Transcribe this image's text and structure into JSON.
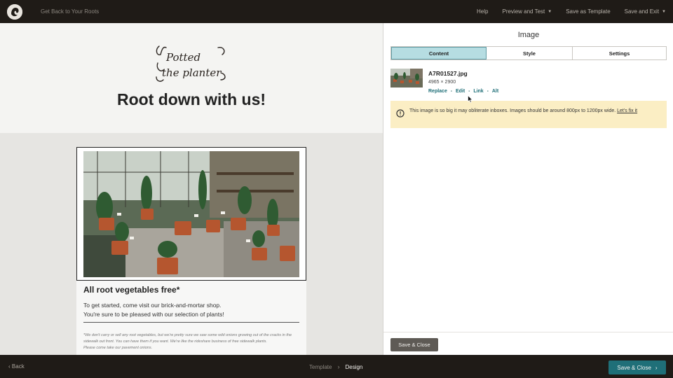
{
  "topbar": {
    "campaign_name": "Get Back to Your Roots",
    "help": "Help",
    "preview_and_test": "Preview and Test",
    "save_as_template": "Save as Template",
    "save_and_exit": "Save and Exit"
  },
  "preview": {
    "headline": "Root down with us!",
    "copy_heading": "All root vegetables free*",
    "copy_line_1": "To get started, come visit our brick-and-mortar shop.",
    "copy_line_2": "You're sure to be pleased with our selection of plants!",
    "fine_print": "*We don't carry or sell any root vegetables, but we're pretty sure we saw some wild onions growing out of the cracks in the sidewalk out front. You can have them if you want. We're like the rideshare business of free sidewalk plants.",
    "fine_print_2": "Please come take our pavement onions."
  },
  "panel": {
    "title": "Image",
    "tabs": [
      {
        "label": "Content",
        "active": true
      },
      {
        "label": "Style",
        "active": false
      },
      {
        "label": "Settings",
        "active": false
      }
    ],
    "file": {
      "name": "A7R01527.jpg",
      "dimensions": "4965 × 2900",
      "actions": [
        "Replace",
        "Edit",
        "Link",
        "Alt"
      ]
    },
    "warning": {
      "text": "This image is so big it may obliterate inboxes. Images should be around 800px to 1200px wide.",
      "link": "Let's fix it"
    },
    "save_close": "Save & Close"
  },
  "bottombar": {
    "back": "Back",
    "step_template": "Template",
    "step_design": "Design",
    "save_close": "Save & Close"
  },
  "colors": {
    "chrome": "#1f1b17",
    "accent_teal": "#1f6f78",
    "tab_active": "#b6dde2",
    "warning_bg": "#fbeec4"
  }
}
